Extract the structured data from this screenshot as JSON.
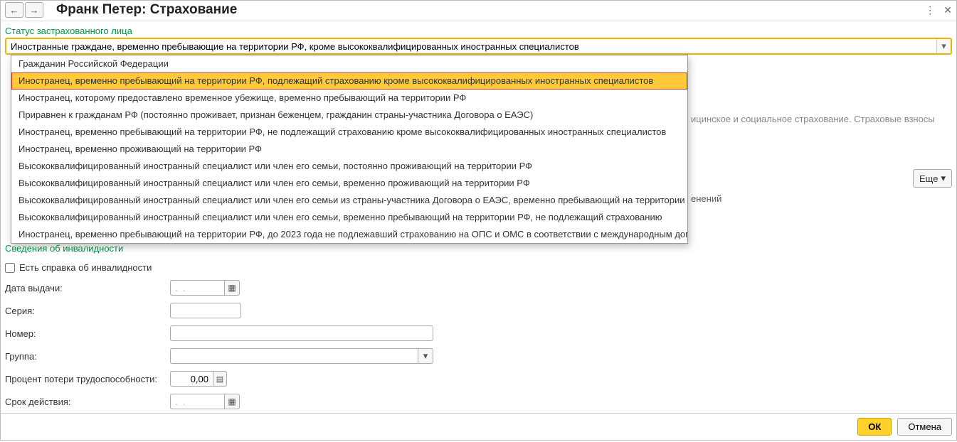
{
  "window": {
    "title": "Франк Петер: Страхование"
  },
  "status": {
    "label": "Статус застрахованного лица",
    "value": "Иностранные граждане, временно пребывающие на территории РФ, кроме высококвалифицированных иностранных специалистов",
    "options": [
      "Гражданин Российской Федерации",
      "Иностранец, временно пребывающий на территории РФ, подлежащий страхованию кроме высококвалифицированных иностранных специалистов",
      "Иностранец, которому предоставлено временное убежище, временно пребывающий на территории РФ",
      "Приравнен к гражданам РФ (постоянно проживает, признан беженцем, гражданин страны-участника Договора о ЕАЭС)",
      "Иностранец, временно пребывающий на территории РФ, не подлежащий страхованию кроме высококвалифицированных иностранных специалистов",
      "Иностранец, временно проживающий на территории РФ",
      "Высококвалифицированный иностранный специалист или член его семьи, постоянно проживающий на территории РФ",
      "Высококвалифицированный иностранный специалист или член его семьи, временно проживающий на территории РФ",
      "Высококвалифицированный иностранный специалист или член его семьи из страны-участника Договора о ЕАЭС, временно пребывающий на территории РФ",
      "Высококвалифицированный иностранный специалист или член его семьи, временно пребывающий на территории РФ, не подлежащий страхованию",
      "Иностранец, временно пребывающий на территории РФ, до 2023 года не подлежавший страхованию на ОПС и ОМС в соответствии с международным договором"
    ],
    "selected_index": 1
  },
  "background_hint": "ицинское и социальное страхование. Страховые взносы",
  "changes_col": "енений",
  "more_label": "Еще",
  "disability": {
    "section_label": "Сведения об инвалидности",
    "checkbox_label": "Есть справка об инвалидности",
    "issue_date_label": "Дата выдачи:",
    "issue_date_value": ".  .",
    "series_label": "Серия:",
    "series_value": "",
    "number_label": "Номер:",
    "number_value": "",
    "group_label": "Группа:",
    "group_value": "",
    "percent_label": "Процент потери трудоспособности:",
    "percent_value": "0,00",
    "validity_label": "Срок действия:",
    "validity_value": ".  ."
  },
  "footer": {
    "ok": "ОК",
    "cancel": "Отмена"
  }
}
